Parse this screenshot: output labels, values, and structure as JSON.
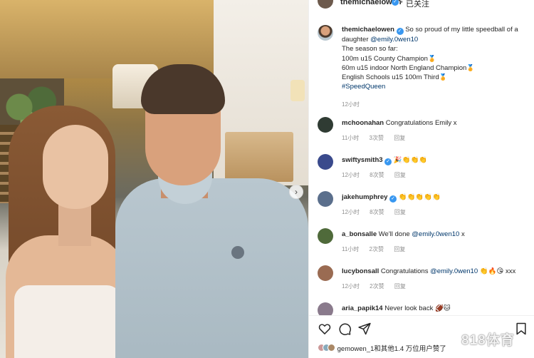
{
  "header": {
    "username": "themichaelowen",
    "separator": "•",
    "follow_status": "已关注"
  },
  "caption": {
    "username": "themichaelowen",
    "line1_text": "So so proud of my little speedball of a daughter",
    "mention": "@emily.0wen10",
    "line2": "The season so far:",
    "line3": "100m u15 County Champion",
    "line4": "60m u15 indoor North England Champion",
    "line5": "English Schools u15 100m Third",
    "hashtag": "#SpeedQueen",
    "time": "12小时"
  },
  "comments": [
    {
      "username": "mchoonahan",
      "text": "Congratulations Emily x",
      "time": "11小时",
      "likes": "3次赞",
      "reply": "回复"
    },
    {
      "username": "swiftysmith3",
      "text": "🎉👏👏👏",
      "verified": true,
      "time": "12小时",
      "likes": "8次赞",
      "reply": "回复"
    },
    {
      "username": "jakehumphrey",
      "text": "👏👏👏👏👏",
      "verified": true,
      "time": "12小时",
      "likes": "8次赞",
      "reply": "回复"
    },
    {
      "username": "a_bonsalle",
      "text_prefix": "We'll done",
      "mention": "@emily.0wen10",
      "text_suffix": "x",
      "time": "11小时",
      "likes": "2次赞",
      "reply": "回复"
    },
    {
      "username": "lucybonsall",
      "text_prefix": "Congratulations",
      "mention": "@emily.0wen10",
      "text_suffix": "👏🔥😘 xxx",
      "time": "12小时",
      "likes": "2次赞",
      "reply": "回复"
    },
    {
      "username": "aria_papik14",
      "text": "Never look back 🏈🐱",
      "time": "",
      "likes": "",
      "reply": ""
    }
  ],
  "likes_line": "gemowen_1和其他1.4 万位用户赞了",
  "watermark": "818体育",
  "icons": [
    "heart-icon",
    "comment-icon",
    "share-icon",
    "bookmark-icon",
    "chevron-right-icon",
    "verified-icon"
  ],
  "colors": {
    "link": "#00376b",
    "verified": "#3897f0",
    "meta": "#8e8e8e"
  }
}
